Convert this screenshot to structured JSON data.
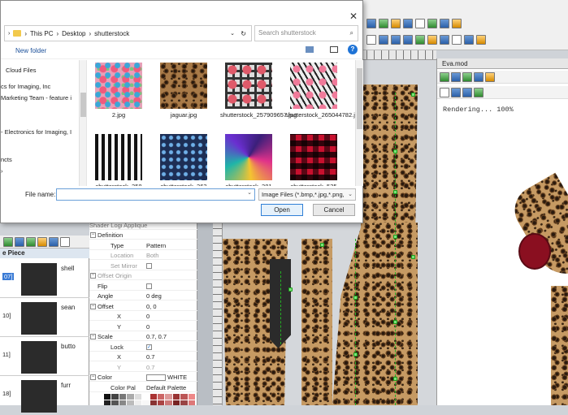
{
  "dialog": {
    "breadcrumb": [
      "This PC",
      "Desktop",
      "shutterstock"
    ],
    "search_placeholder": "Search shutterstock",
    "new_folder": "New folder",
    "nav_items": [
      "Cloud Files",
      "cs for Imaging, Inc",
      "Marketing Team - feature i",
      "- Electronics for Imaging, I",
      "ncts"
    ],
    "files": [
      {
        "name": "2.jpg",
        "pattern": "floral-pink"
      },
      {
        "name": "jaguar.jpg",
        "pattern": "leopard"
      },
      {
        "name": "shutterstock_257909657.jpg",
        "pattern": "plaid-floral"
      },
      {
        "name": "shutterstock_265044782.jpg",
        "pattern": "zebra-floral"
      },
      {
        "name": "shutterstock_358",
        "pattern": "stripes"
      },
      {
        "name": "shutterstock_363",
        "pattern": "navy-dots"
      },
      {
        "name": "shutterstock_381",
        "pattern": "geometric"
      },
      {
        "name": "shutterstock_535",
        "pattern": "buffalo-check"
      }
    ],
    "file_name_label": "File name:",
    "file_name_value": "",
    "file_type": "Image Files (*.bmp,*.jpg,*.png,",
    "open_label": "Open",
    "cancel_label": "Cancel"
  },
  "eva": {
    "title": "Eva.mod",
    "status": "Rendering... 100%"
  },
  "pieces": {
    "header": "e Piece",
    "items": [
      {
        "num": "07]",
        "label": "shell",
        "selected": true
      },
      {
        "num": "10]",
        "label": "sean"
      },
      {
        "num": "11]",
        "label": "butto"
      },
      {
        "num": "18]",
        "label": "furr"
      }
    ]
  },
  "properties": {
    "header": "Shader Logi Applique",
    "rows": [
      {
        "key": "Definition",
        "value": "",
        "level": 0,
        "toggle": "−"
      },
      {
        "key": "Type",
        "value": "Pattern",
        "level": 1
      },
      {
        "key": "Location",
        "value": "Both",
        "level": 1,
        "dim": true
      },
      {
        "key": "Set Mirror",
        "value": "",
        "level": 1,
        "dim": true,
        "check": true
      },
      {
        "key": "Offset Origin",
        "value": "",
        "level": 0,
        "toggle": "+",
        "dim": true
      },
      {
        "key": "Flip",
        "value": "",
        "level": 0,
        "check": true
      },
      {
        "key": "Angle",
        "value": "0 deg",
        "level": 0
      },
      {
        "key": "Offset",
        "value": "0, 0",
        "level": 0,
        "toggle": "−"
      },
      {
        "key": "X",
        "value": "0",
        "level": 2
      },
      {
        "key": "Y",
        "value": "0",
        "level": 2
      },
      {
        "key": "Scale",
        "value": "0.7, 0.7",
        "level": 0,
        "toggle": "−"
      },
      {
        "key": "Lock",
        "value": "✓",
        "level": 1,
        "check": true
      },
      {
        "key": "X",
        "value": "0.7",
        "level": 2
      },
      {
        "key": "Y",
        "value": "0.7",
        "level": 2,
        "dim": true
      },
      {
        "key": "Color",
        "value": "WHITE",
        "level": 0,
        "toggle": "−",
        "swatch": true
      },
      {
        "key": "Color Pal",
        "value": "Default Palette",
        "level": 1
      }
    ]
  },
  "colors": {
    "accent": "#2f7fd6",
    "leopard_base": "#c69a63",
    "guide_green": "#24b024"
  }
}
